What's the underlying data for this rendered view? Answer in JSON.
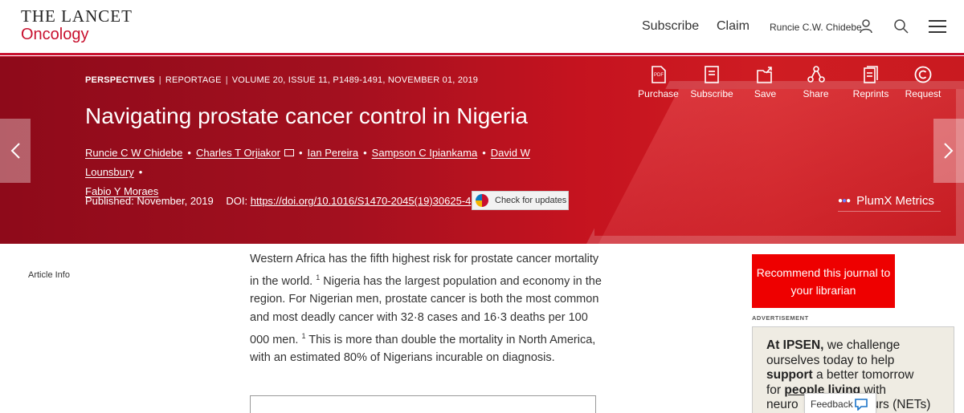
{
  "header": {
    "logo_top": "THE LANCET",
    "logo_bottom": "Oncology",
    "subscribe": "Subscribe",
    "claim": "Claim",
    "user_name": "Runcie C.W. Chidebe"
  },
  "article": {
    "section": "PERSPECTIVES",
    "type": "REPORTAGE",
    "citation": "VOLUME 20, ISSUE 11, P1489-1491, NOVEMBER 01, 2019",
    "title": "Navigating prostate cancer control in Nigeria",
    "authors": [
      "Runcie C W Chidebe",
      "Charles T Orjiakor",
      "Ian Pereira",
      "Sampson C Ipiankama",
      "David W Lounsbury",
      "Fabio Y Moraes"
    ],
    "published_label": "Published:",
    "published_value": "November, 2019",
    "doi_label": "DOI:",
    "doi": "https://doi.org/10.1016/S1470-2045(19)30625-4",
    "check_updates": "Check for updates",
    "plumx": "PlumX Metrics"
  },
  "actions": [
    {
      "label": "Purchase",
      "icon": "pdf-icon"
    },
    {
      "label": "Subscribe",
      "icon": "journal-icon"
    },
    {
      "label": "Save",
      "icon": "save-icon"
    },
    {
      "label": "Share",
      "icon": "share-icon"
    },
    {
      "label": "Reprints",
      "icon": "reprints-icon"
    },
    {
      "label": "Request",
      "icon": "copyright-icon"
    }
  ],
  "sidebar": {
    "article_info": "Article Info"
  },
  "body": {
    "p1": "Western Africa has the fifth highest risk for prostate cancer mortality in the world.",
    "ref1": "1",
    "p2": "Nigeria has the largest population and economy in the region. For Nigerian men, prostate cancer is both the most common and most deadly cancer with 32·8 cases and 16·3 deaths per 100 000 men.",
    "ref2": "1",
    "p3": "This is more than double the mortality in North America, with an estimated 80% of Nigerians incurable on diagnosis."
  },
  "right_rail": {
    "recommend": "Recommend this journal to your librarian",
    "advertisement": "ADVERTISEMENT",
    "ad_line1_bold": "At IPSEN,",
    "ad_line1_rest": "we challenge",
    "ad_line2": "ourselves today to help",
    "ad_line3_bold": "support",
    "ad_line3_rest": "a better tomorrow",
    "ad_line4_a": "for",
    "ad_line4_bold": "people living",
    "ad_line4_rest": "with",
    "ad_line5_a": "neuro",
    "ad_line5_b": "ours (NETs)",
    "feedback": "Feedback"
  },
  "colors": {
    "brand_red": "#c8102e",
    "button_red": "#e00000"
  }
}
